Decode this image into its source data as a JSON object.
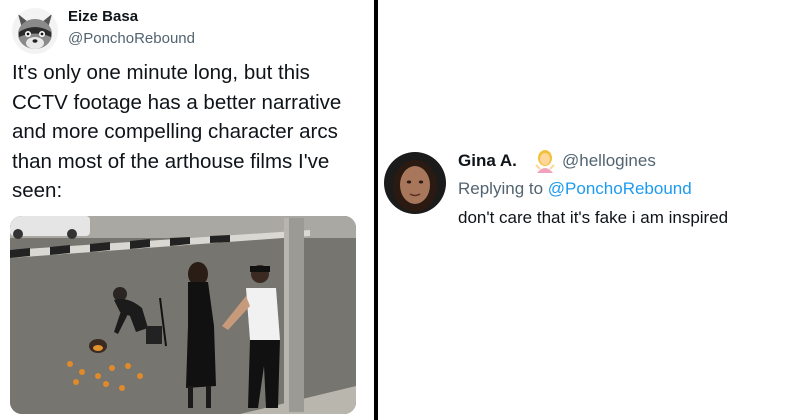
{
  "tweet": {
    "author_name": "Eize Basa",
    "author_handle": "@PonchoRebound",
    "text": "It's only one minute long, but this CCTV footage has a better narrative and more compelling character arcs than most of the arthouse films I've seen:",
    "avatar_icon": "raccoon-avatar",
    "media": "cctv-video-frame"
  },
  "reply": {
    "author_name": "Gina A.",
    "emoji_icon": "person-shrugging-emoji",
    "author_handle": "@hellogines",
    "replying_prefix": "Replying to ",
    "replying_handle": "@PonchoRebound",
    "text": "don't care that it's fake i am inspired"
  },
  "colors": {
    "link": "#1d9bf0",
    "secondary_text": "#536471",
    "primary_text": "#0f1419",
    "divider": "#000000"
  }
}
